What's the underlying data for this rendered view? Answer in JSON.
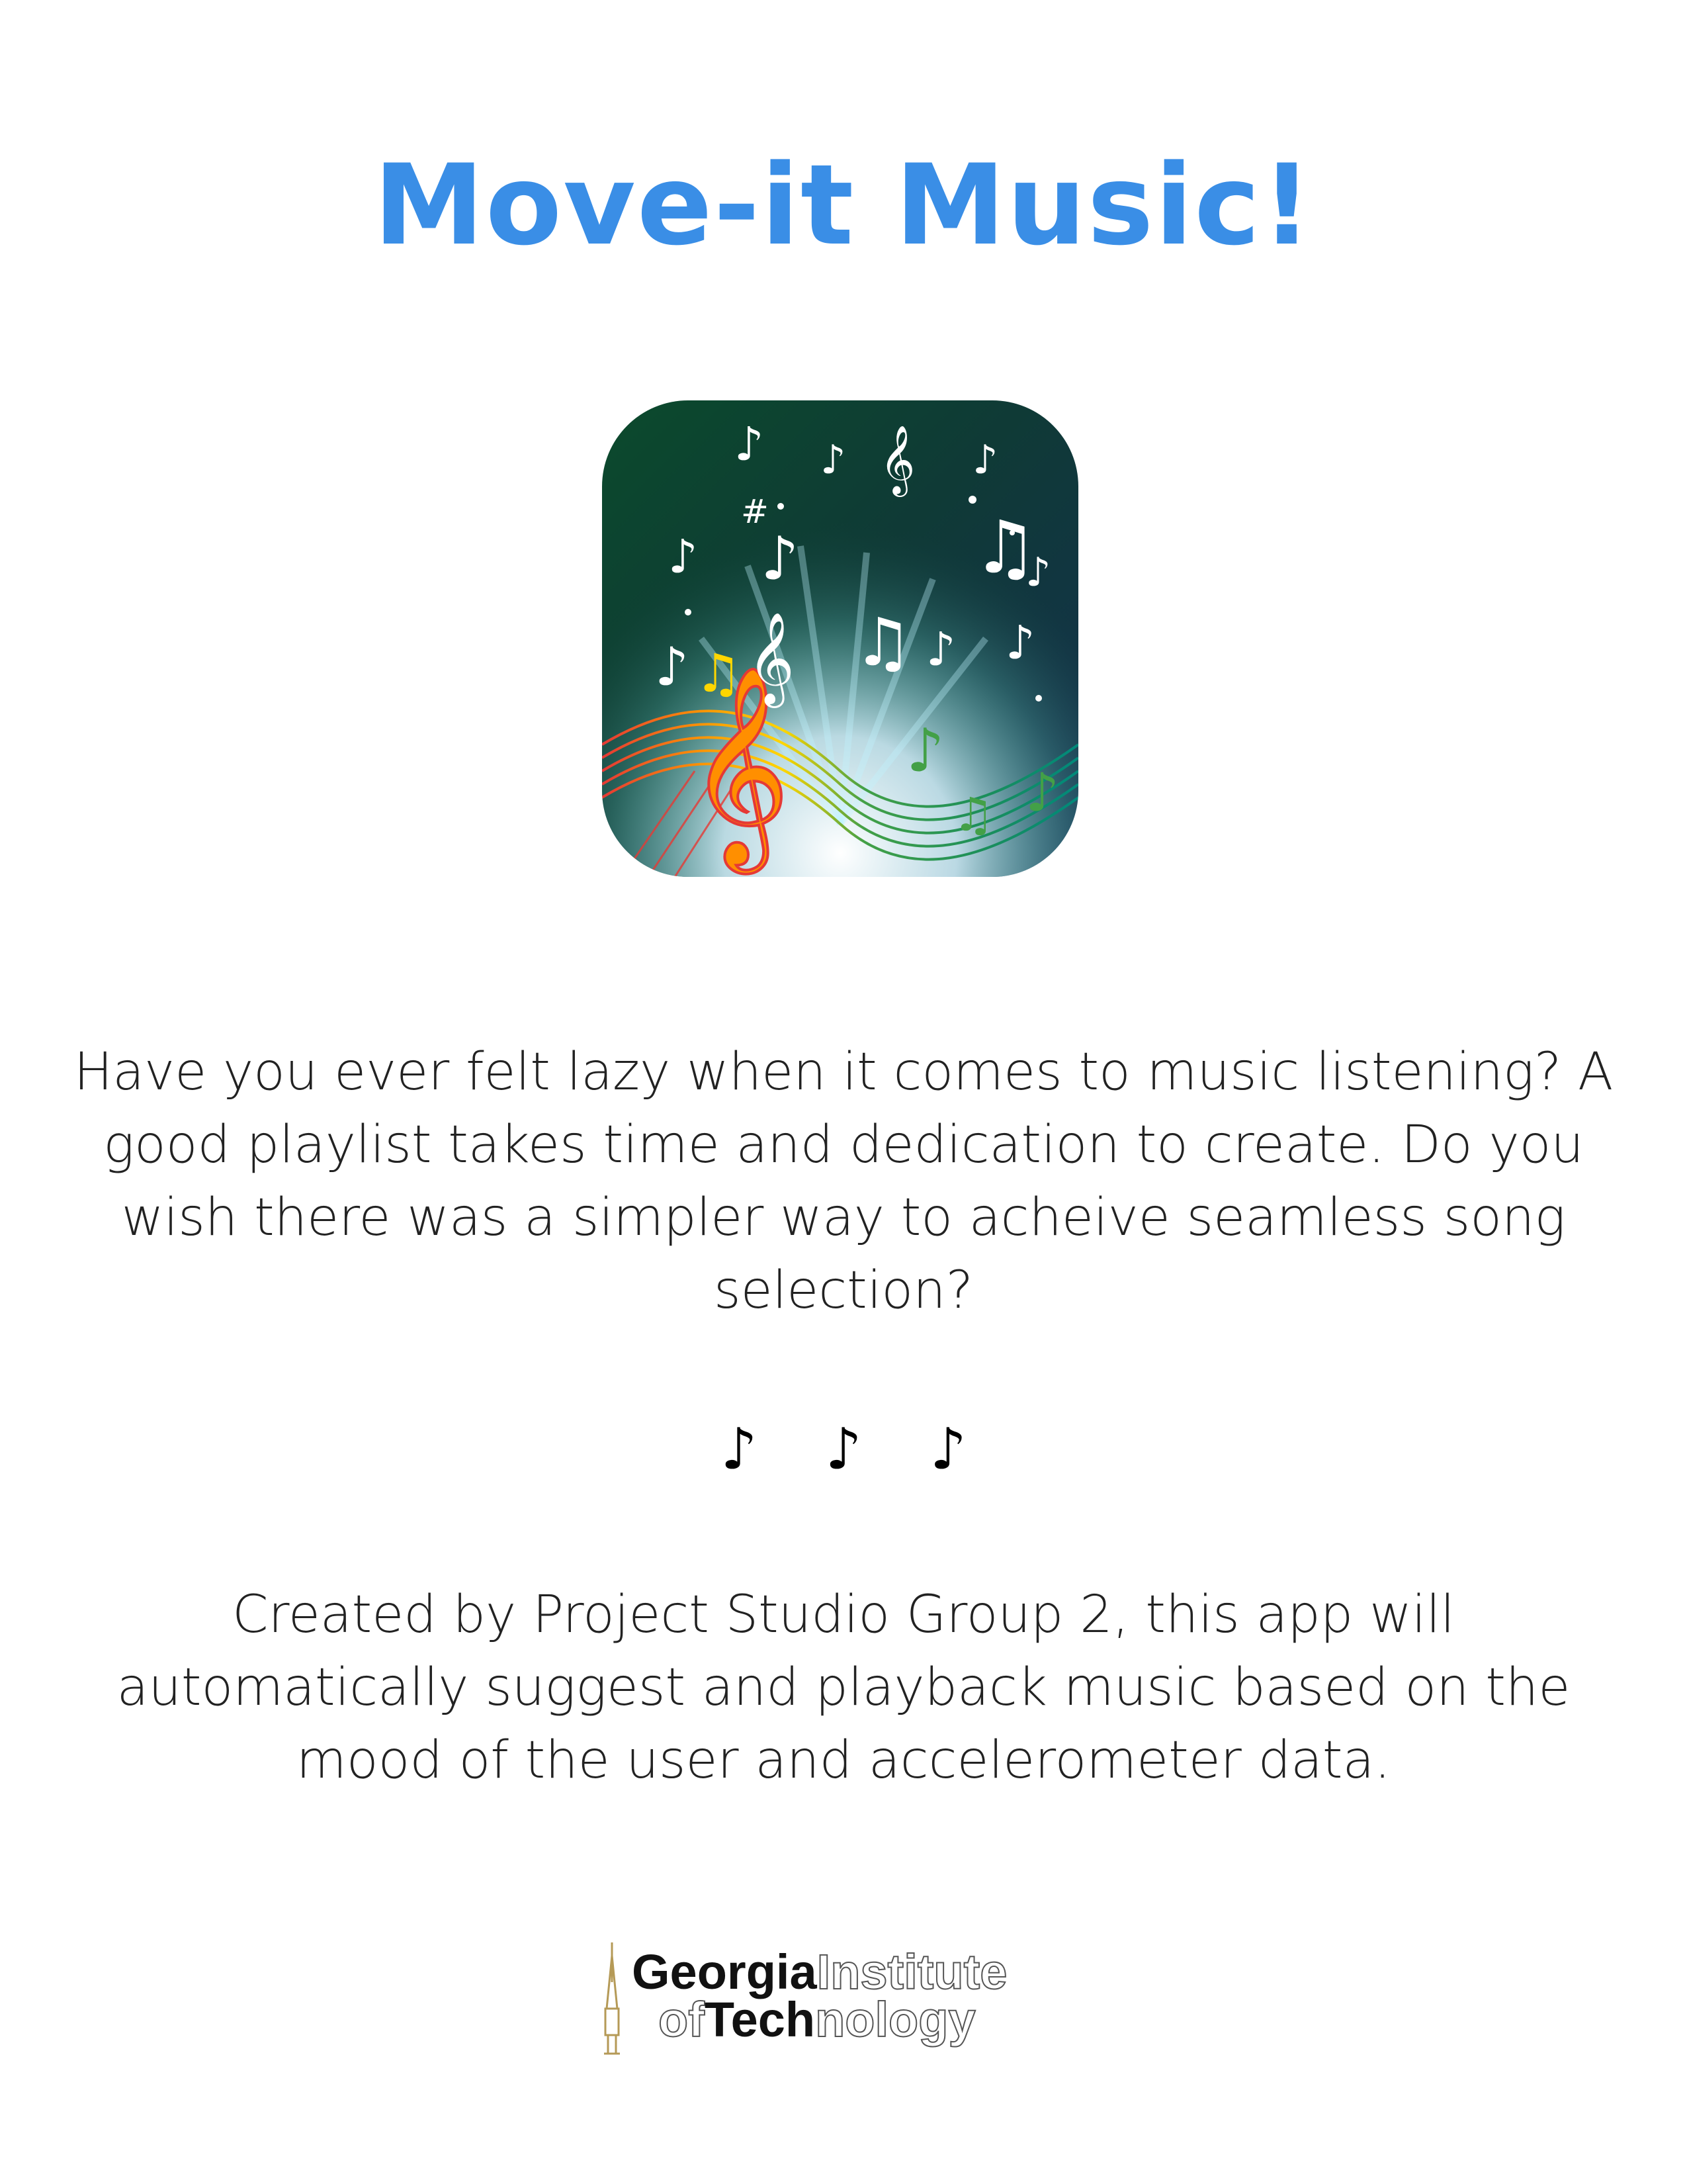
{
  "title": "Move-it Music!",
  "app_icon": {
    "name": "music-notes-app-icon",
    "colors": {
      "background_top": "#0b3b2a",
      "background_bottom": "#1b2f4a",
      "glow": "#e8f7ff",
      "rainbow": [
        "#e53935",
        "#ff9800",
        "#ffd600",
        "#43a047",
        "#00897b"
      ]
    }
  },
  "intro_text": "Have you ever felt lazy when it comes to music listening?  A good playlist takes time and dedication to create.  Do you wish there was a simpler way to acheive seamless song selection?",
  "notes_divider": [
    "♪",
    "♪",
    "♪"
  ],
  "credit_text": "Created by Project Studio Group 2, this app will automatically suggest and playback music based on the mood of the user and accelerometer data.",
  "logo": {
    "line1_bold": "Georgia",
    "line1_outline": "Institute",
    "line2_outline_prefix": "of",
    "line2_bold": "Tech",
    "line2_outline_suffix": "nology",
    "spire_color": "#b59a57"
  }
}
